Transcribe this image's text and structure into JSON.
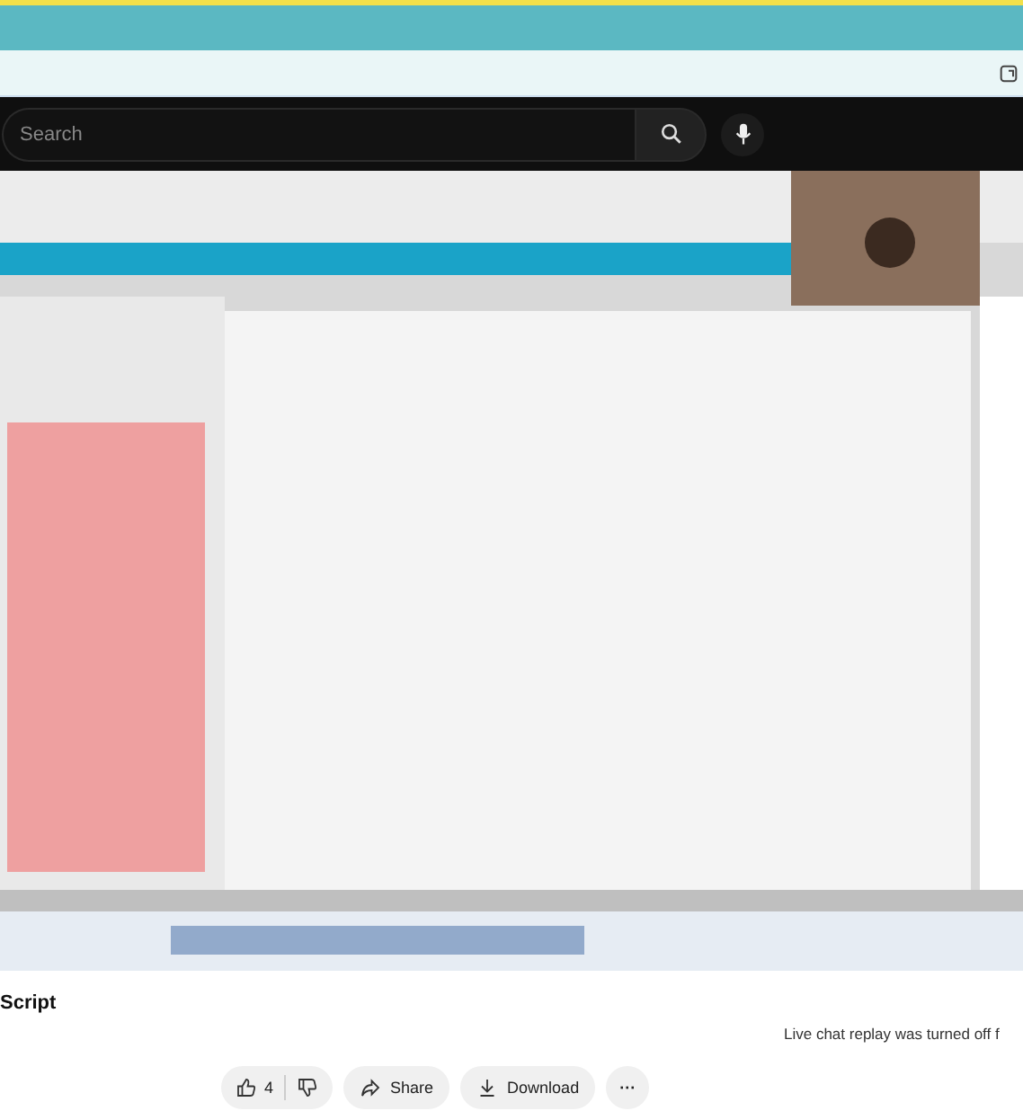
{
  "search": {
    "placeholder": "Search"
  },
  "title": "Script",
  "chat_notice": "Live chat replay was turned off f",
  "actions": {
    "likes": "4",
    "buttons": [
      {
        "kind": "share",
        "label": "Share"
      },
      {
        "kind": "download",
        "label": "Download"
      },
      {
        "kind": "more",
        "label": "···"
      }
    ]
  }
}
